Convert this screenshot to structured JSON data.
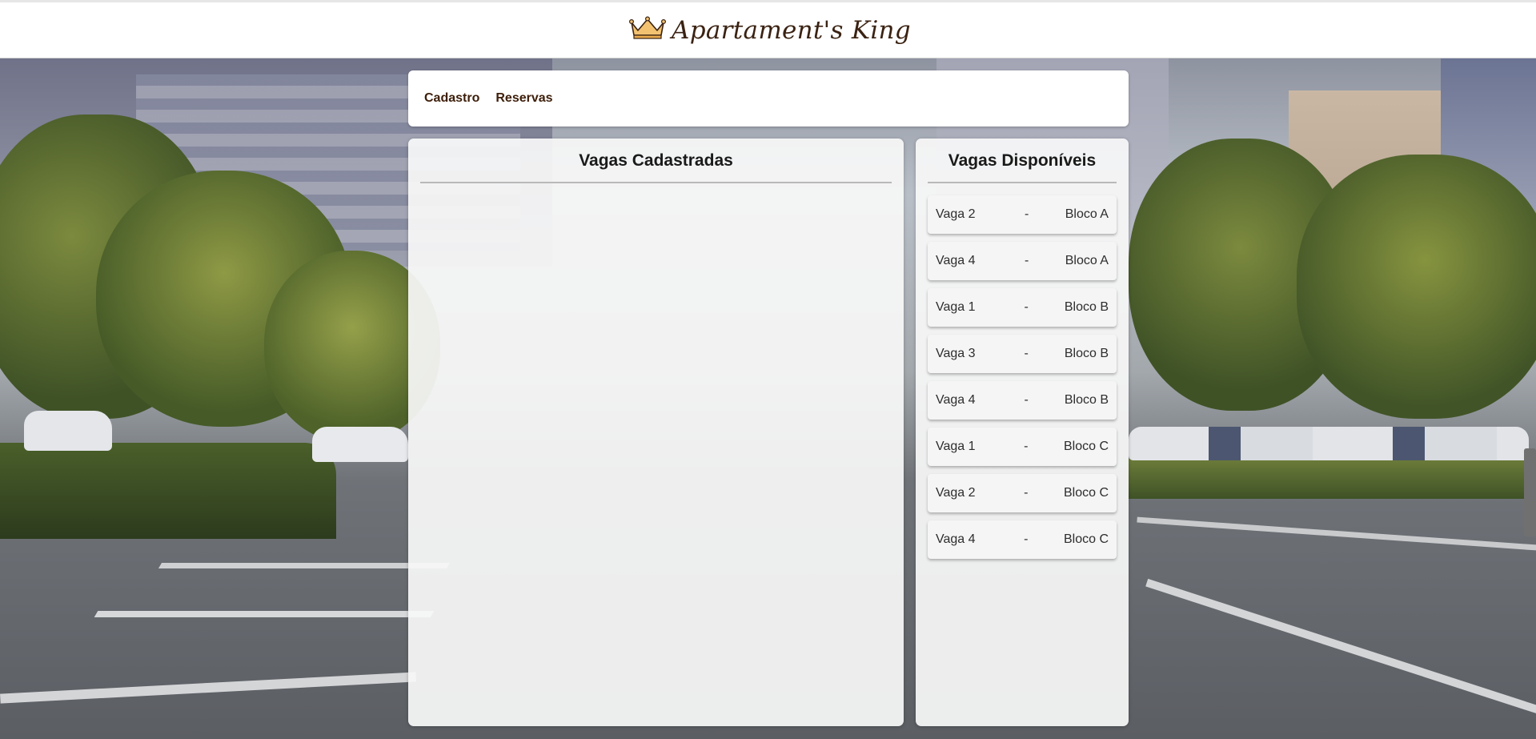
{
  "header": {
    "brand_name": "Apartament's King",
    "logo_icon": "crown-icon",
    "accent_color": "#e8b25a"
  },
  "nav": {
    "items": [
      {
        "label": "Cadastro"
      },
      {
        "label": "Reservas"
      }
    ]
  },
  "panels": {
    "registered": {
      "title": "Vagas Cadastradas",
      "items": []
    },
    "available": {
      "title": "Vagas Disponíveis",
      "items": [
        {
          "vaga": "Vaga 2",
          "sep": "-",
          "bloco": "Bloco A"
        },
        {
          "vaga": "Vaga 4",
          "sep": "-",
          "bloco": "Bloco A"
        },
        {
          "vaga": "Vaga 1",
          "sep": "-",
          "bloco": "Bloco B"
        },
        {
          "vaga": "Vaga 3",
          "sep": "-",
          "bloco": "Bloco B"
        },
        {
          "vaga": "Vaga 4",
          "sep": "-",
          "bloco": "Bloco B"
        },
        {
          "vaga": "Vaga 1",
          "sep": "-",
          "bloco": "Bloco C"
        },
        {
          "vaga": "Vaga 2",
          "sep": "-",
          "bloco": "Bloco C"
        },
        {
          "vaga": "Vaga 4",
          "sep": "-",
          "bloco": "Bloco C"
        }
      ]
    }
  },
  "colors": {
    "nav_text": "#3d1e0a",
    "brand_text": "#3a2212"
  }
}
